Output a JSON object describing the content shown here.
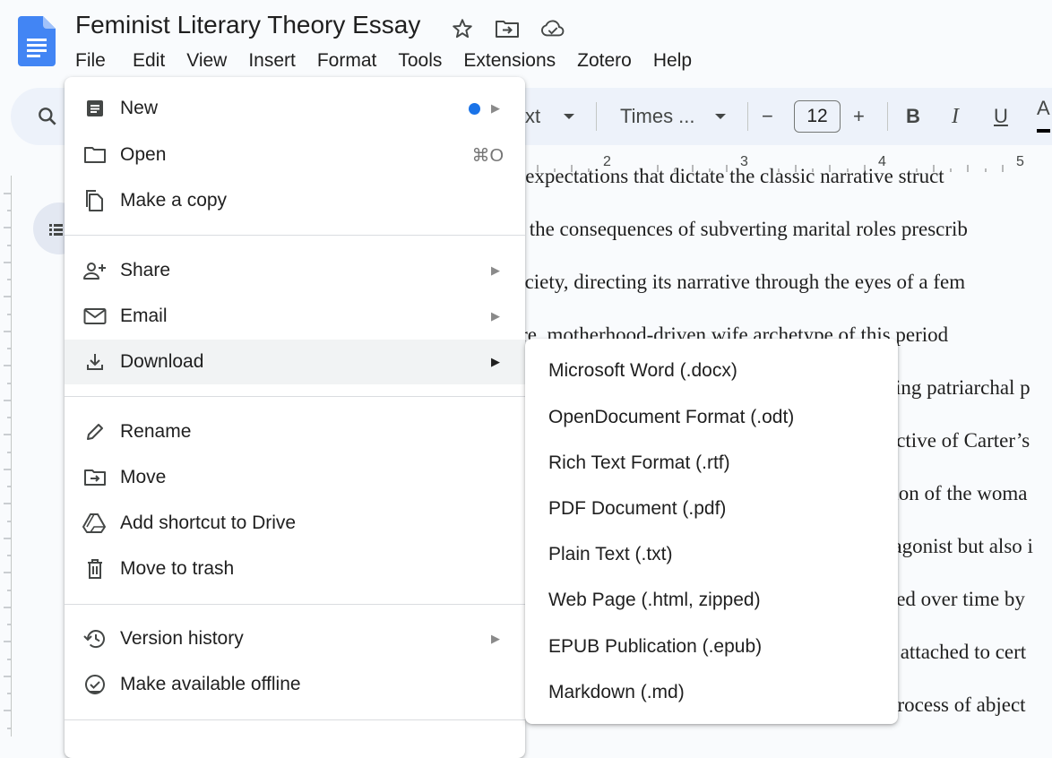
{
  "document": {
    "title": "Feminist Literary Theory Essay"
  },
  "menubar": {
    "items": [
      "File",
      "Edit",
      "View",
      "Insert",
      "Format",
      "Tools",
      "Extensions",
      "Zotero",
      "Help"
    ]
  },
  "toolbar": {
    "style_partial": "xt",
    "font": "Times ...",
    "font_size": "12",
    "minus": "−",
    "plus": "+",
    "bold": "B",
    "italic": "I",
    "underline": "U",
    "text_color": "A"
  },
  "ruler": {
    "numbers": [
      "2",
      "3",
      "4",
      "5"
    ]
  },
  "document_body": {
    "lines": [
      "te the expectations that dictate the classic narrative struct",
      "mines the consequences of subverting marital roles prescrib",
      "ary society, directing its narrative through the eyes of a fem",
      " demure, motherhood-driven wife archetype of this period",
      "sing patriarchal p",
      "ective of Carter’s",
      "tion of the woma",
      "tagonist but also i",
      "ced over time by",
      "s attached to cert",
      "process of abject"
    ]
  },
  "file_menu": {
    "new": "New",
    "open": "Open",
    "open_shortcut": "⌘O",
    "make_copy": "Make a copy",
    "share": "Share",
    "email": "Email",
    "download": "Download",
    "rename": "Rename",
    "move": "Move",
    "add_shortcut": "Add shortcut to Drive",
    "move_to_trash": "Move to trash",
    "version_history": "Version history",
    "make_offline": "Make available offline",
    "arrow": "▶"
  },
  "download_submenu": {
    "items": [
      "Microsoft Word (.docx)",
      "OpenDocument Format (.odt)",
      "Rich Text Format (.rtf)",
      "PDF Document (.pdf)",
      "Plain Text (.txt)",
      "Web Page (.html, zipped)",
      "EPUB Publication (.epub)",
      "Markdown (.md)"
    ]
  },
  "colors": {
    "highlight": "#ffe000",
    "accent_blue": "#1a73e8",
    "toolbar_bg": "#edf2fa"
  }
}
